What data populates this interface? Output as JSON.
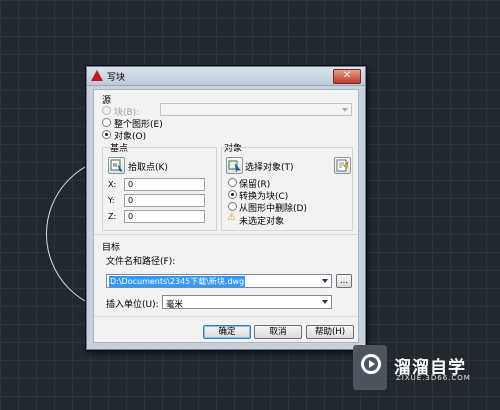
{
  "dialog": {
    "title": "写块",
    "close_glyph": "✕",
    "source": {
      "label": "源",
      "block_radio": "块(B):",
      "block_combo_value": "",
      "entire_drawing_radio": "整个图形(E)",
      "objects_radio": "对象(O)",
      "selected": "objects"
    },
    "base_point": {
      "label": "基点",
      "pick_point_label": "拾取点(K)",
      "x_label": "X:",
      "x_value": "0",
      "y_label": "Y:",
      "y_value": "0",
      "z_label": "Z:",
      "z_value": "0"
    },
    "objects": {
      "label": "对象",
      "select_objects_label": "选择对象(T)",
      "retain_radio": "保留(R)",
      "convert_radio": "转换为块(C)",
      "delete_radio": "从图形中删除(D)",
      "selected": "convert",
      "status_text": "未选定对象",
      "warning_glyph": "⚠"
    },
    "destination": {
      "label": "目标",
      "file_path_label": "文件名和路径(F):",
      "file_path_value": "D:\\Documents\\2345下载\\新块.dwg",
      "browse_button": "...",
      "insert_units_label": "插入单位(U):",
      "insert_units_value": "毫米"
    },
    "buttons": {
      "ok": "确定",
      "cancel": "取消",
      "help": "帮助(H)"
    }
  },
  "watermark": {
    "title": "溜溜自学",
    "url": "ZIXUE.3D66.COM"
  },
  "colors": {
    "canvas": "#212830",
    "dialog_frame": "#c7d2dd",
    "selection": "#3399ff",
    "autocad_red": "#c8161d"
  }
}
